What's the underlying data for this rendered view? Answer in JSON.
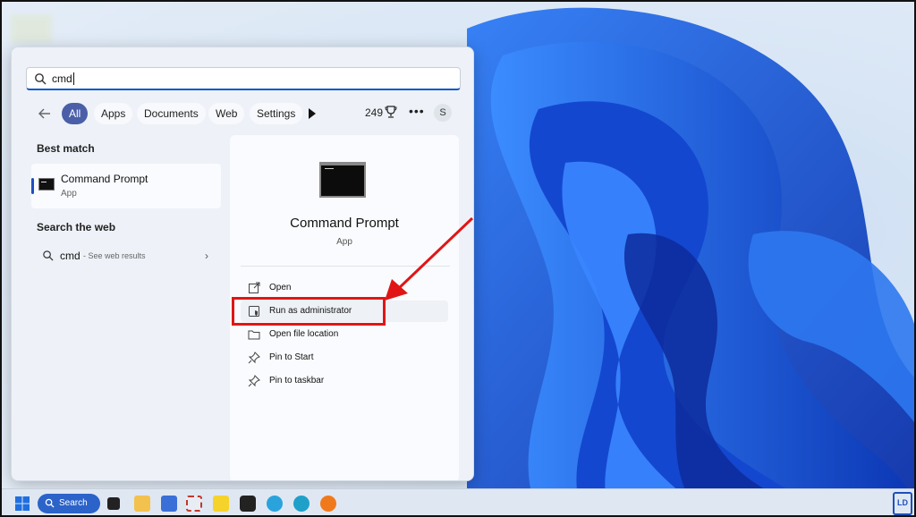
{
  "search": {
    "query": "cmd"
  },
  "filters": {
    "back_icon": "arrow-left-icon",
    "tabs": [
      "All",
      "Apps",
      "Documents",
      "Web",
      "Settings"
    ],
    "active": "All",
    "count": "249",
    "avatar": "S"
  },
  "left": {
    "best_match_title": "Best match",
    "best_match": {
      "name": "Command Prompt",
      "type": "App"
    },
    "search_web_title": "Search the web",
    "web_result": {
      "query": "cmd",
      "hint": "- See web results"
    }
  },
  "detail": {
    "name": "Command Prompt",
    "type": "App",
    "actions": [
      {
        "label": "Open",
        "icon": "open-external-icon"
      },
      {
        "label": "Run as administrator",
        "icon": "shield-icon"
      },
      {
        "label": "Open file location",
        "icon": "folder-icon"
      },
      {
        "label": "Pin to Start",
        "icon": "pin-icon"
      },
      {
        "label": "Pin to taskbar",
        "icon": "pin-icon"
      }
    ]
  },
  "taskbar": {
    "search_label": "Search",
    "icons": [
      "windows-start-icon",
      "search-icon",
      "task-view-icon",
      "file-explorer-icon",
      "microsoft-store-icon",
      "snipping-tool-icon",
      "sticky-notes-icon",
      "terminal-icon",
      "telegram-icon",
      "edge-icon",
      "firefox-icon"
    ]
  },
  "colors": {
    "accent": "#4a5fa8",
    "highlight": "#e01616",
    "wallpaper": "#1f5fe0"
  }
}
